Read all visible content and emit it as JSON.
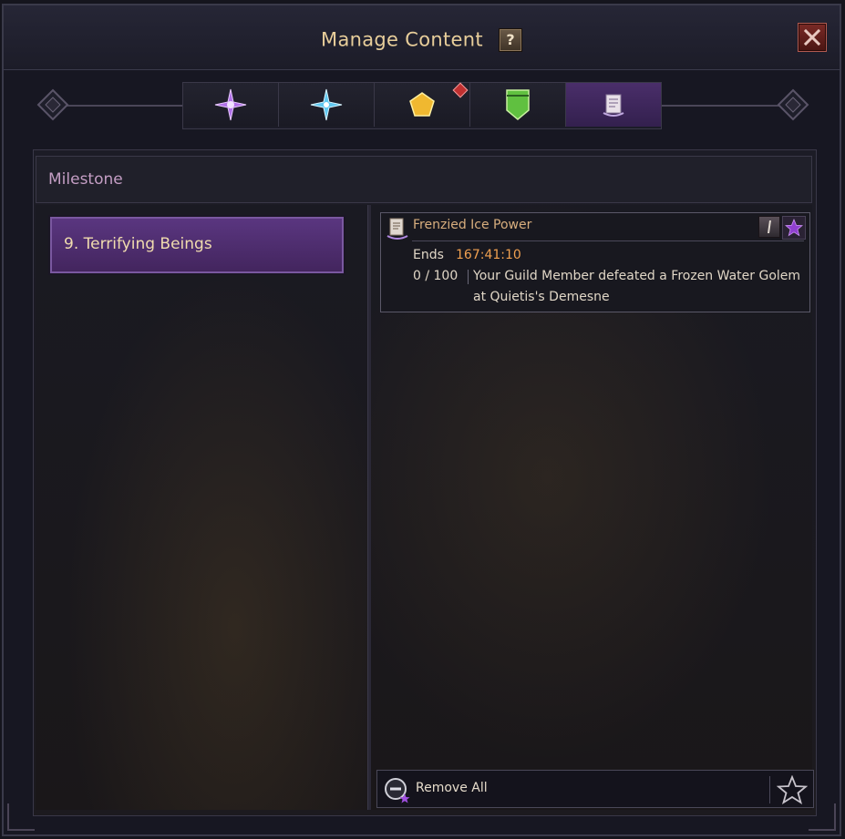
{
  "window": {
    "title": "Manage Content",
    "help_label": "?",
    "close_label": "X"
  },
  "tabs": [
    {
      "icon": "violet-star-icon",
      "color": "#b070e8",
      "active": false
    },
    {
      "icon": "blue-star-icon",
      "color": "#60c8f0",
      "active": false
    },
    {
      "icon": "gold-pentagon-icon",
      "color": "#f0b830",
      "active": false,
      "alert": true
    },
    {
      "icon": "green-banner-icon",
      "color": "#60c040",
      "active": false
    },
    {
      "icon": "scroll-icon",
      "color": "#e0d8e8",
      "active": true
    }
  ],
  "section": {
    "header": "Milestone"
  },
  "milestones": [
    {
      "label": "9. Terrifying Beings",
      "selected": true
    }
  ],
  "mission": {
    "title": "Frenzied Ice Power",
    "ends_label": "Ends",
    "ends_value": "167:41:10",
    "progress": "0 / 100",
    "description": "Your Guild Member defeated a Frozen Water Golem at Quietis's Demesne"
  },
  "footer": {
    "remove_all_label": "Remove All"
  },
  "colors": {
    "accent_purple": "#5a3680",
    "title_gold": "#e8ce9a",
    "timer_orange": "#f0a050",
    "close_red": "#7a2a26"
  }
}
